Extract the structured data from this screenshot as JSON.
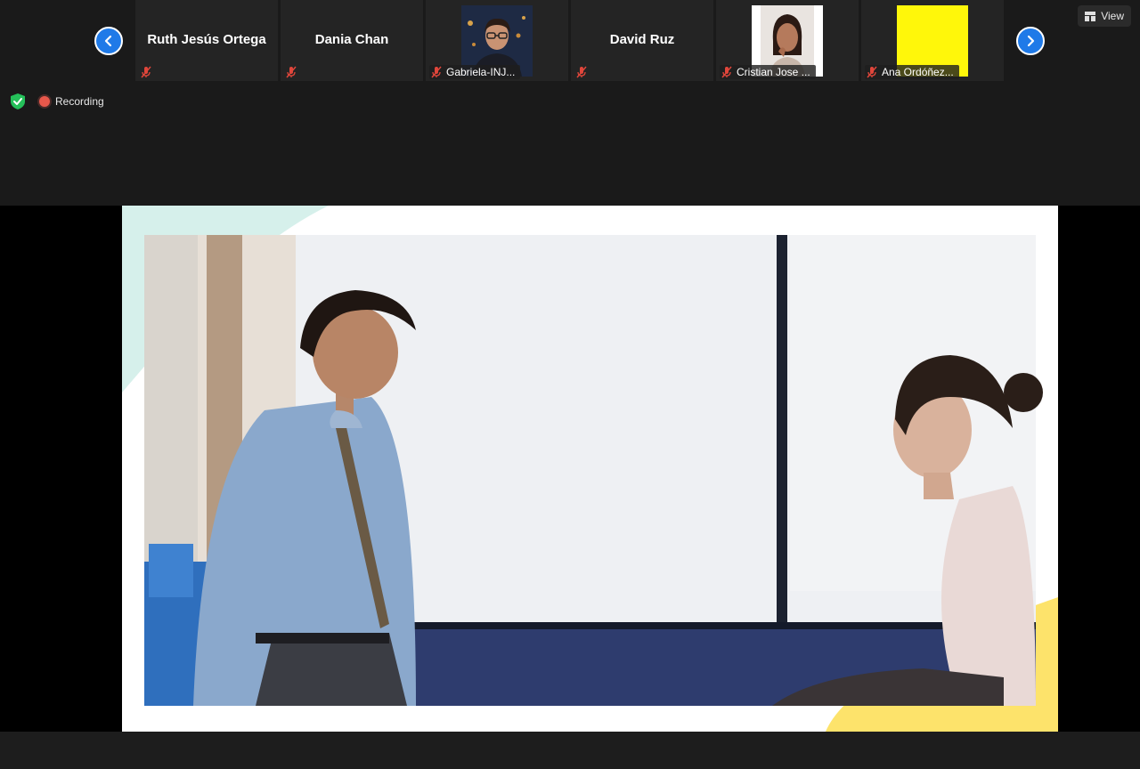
{
  "participants": [
    {
      "name": "Ruth Jesús Ortega",
      "label_style": "big"
    },
    {
      "name": "Dania Chan",
      "label_style": "big"
    },
    {
      "name": "Gabriela-INJ...",
      "label_style": "bar",
      "photo": "man-glasses-avatar"
    },
    {
      "name": "David Ruz",
      "label_style": "big"
    },
    {
      "name": "Cristian Jose ...",
      "label_style": "bar",
      "photo": "woman-portrait-avatar"
    },
    {
      "name": "Ana Ordóñez...",
      "label_style": "bar",
      "photo": "yellow-square-avatar"
    }
  ],
  "toolbar": {
    "view_label": "View"
  },
  "status": {
    "recording_label": "Recording"
  },
  "colors": {
    "accent": "#1f7ae8",
    "mute": "#e0463b",
    "recording": "#e8584b",
    "security": "#25c05a"
  },
  "icons": [
    "chevron-left-icon",
    "chevron-right-icon",
    "grid-icon",
    "shield-icon",
    "mic-muted-icon",
    "recording-dot-icon"
  ]
}
